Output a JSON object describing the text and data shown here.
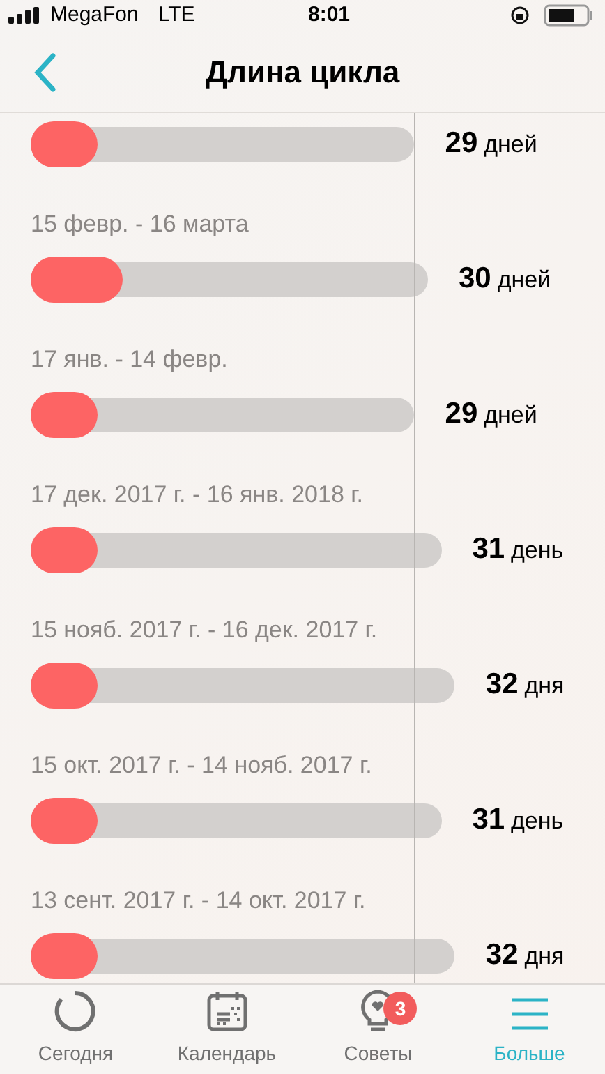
{
  "status_bar": {
    "carrier": "MegaFon",
    "network": "LTE",
    "time": "8:01"
  },
  "nav": {
    "title": "Длина цикла"
  },
  "cycles": [
    {
      "fill": {
        "level": 0.175
      },
      "days": "29",
      "unit": "дней"
    },
    {
      "period": "15 февр. - 16 марта",
      "fill": {
        "level": 0.232
      },
      "days": "30",
      "unit": "дней"
    },
    {
      "period": "17 янв. - 14 февр.",
      "fill": {
        "level": 0.175
      },
      "days": "29",
      "unit": "дней"
    },
    {
      "period": "17 дек. 2017 г. - 16 янв. 2018 г.",
      "fill": {
        "level": 0.163
      },
      "days": "31",
      "unit": "день"
    },
    {
      "period": "15 нояб. 2017 г. - 16 дек. 2017 г.",
      "fill": {
        "level": 0.158
      },
      "days": "32",
      "unit": "дня"
    },
    {
      "period": "15 окт. 2017 г. - 14 нояб. 2017 г.",
      "fill": {
        "level": 0.163
      },
      "days": "31",
      "unit": "день"
    },
    {
      "period": "13 сент. 2017 г. - 14 окт. 2017 г.",
      "fill": {
        "level": 0.158
      },
      "days": "32",
      "unit": "дня"
    }
  ],
  "tabs": [
    {
      "kind": "today",
      "label": "Сегодня",
      "selected": false
    },
    {
      "kind": "calendar",
      "label": "Календарь",
      "selected": false
    },
    {
      "kind": "tips",
      "label": "Советы",
      "badge": "3",
      "selected": false
    },
    {
      "kind": "more",
      "label": "Больше",
      "selected": true
    }
  ]
}
